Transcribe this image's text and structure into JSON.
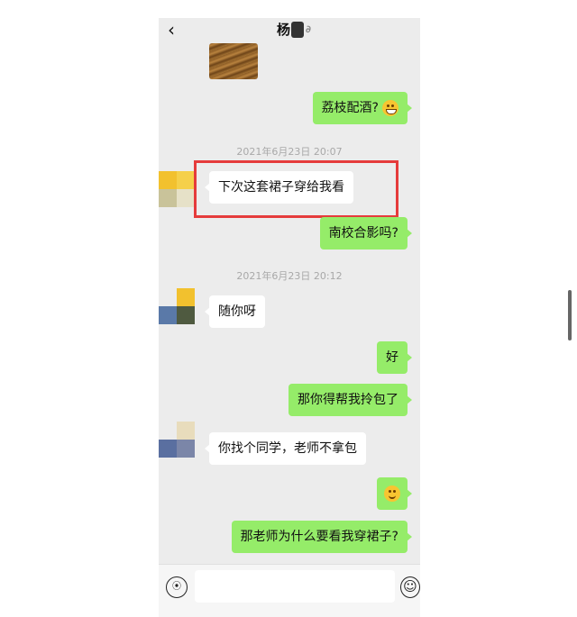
{
  "header": {
    "back_icon": "chevron-left-icon",
    "title": "杨",
    "ear_icon": "ear-icon"
  },
  "messages": [
    {
      "type": "image",
      "side": "left",
      "icon": "wood-photo"
    },
    {
      "type": "text",
      "side": "right",
      "text": "荔枝配酒?",
      "emoji": "grin-emoji"
    },
    {
      "type": "timestamp",
      "text": "2021年6月23日 20:07"
    },
    {
      "type": "text",
      "side": "left",
      "text": "下次这套裙子穿给我看",
      "highlighted": true
    },
    {
      "type": "text",
      "side": "right",
      "text": "南校合影吗?"
    },
    {
      "type": "timestamp",
      "text": "2021年6月23日 20:12"
    },
    {
      "type": "text",
      "side": "left",
      "text": "随你呀"
    },
    {
      "type": "text",
      "side": "right",
      "text": "好"
    },
    {
      "type": "text",
      "side": "right",
      "text": "那你得帮我拎包了"
    },
    {
      "type": "text",
      "side": "left",
      "text": "你找个同学，老师不拿包"
    },
    {
      "type": "emoji",
      "side": "right",
      "emoji": "smile-emoji"
    },
    {
      "type": "text",
      "side": "right",
      "text": "那老师为什么要看我穿裙子?"
    }
  ],
  "footer": {
    "voice_icon": "voice-icon",
    "input_value": "",
    "emoji_icon": "emoji-icon"
  },
  "colors": {
    "chat_bg": "#ececec",
    "my_bubble": "#95ec69",
    "their_bubble": "#ffffff",
    "highlight_border": "#e53b3b"
  }
}
